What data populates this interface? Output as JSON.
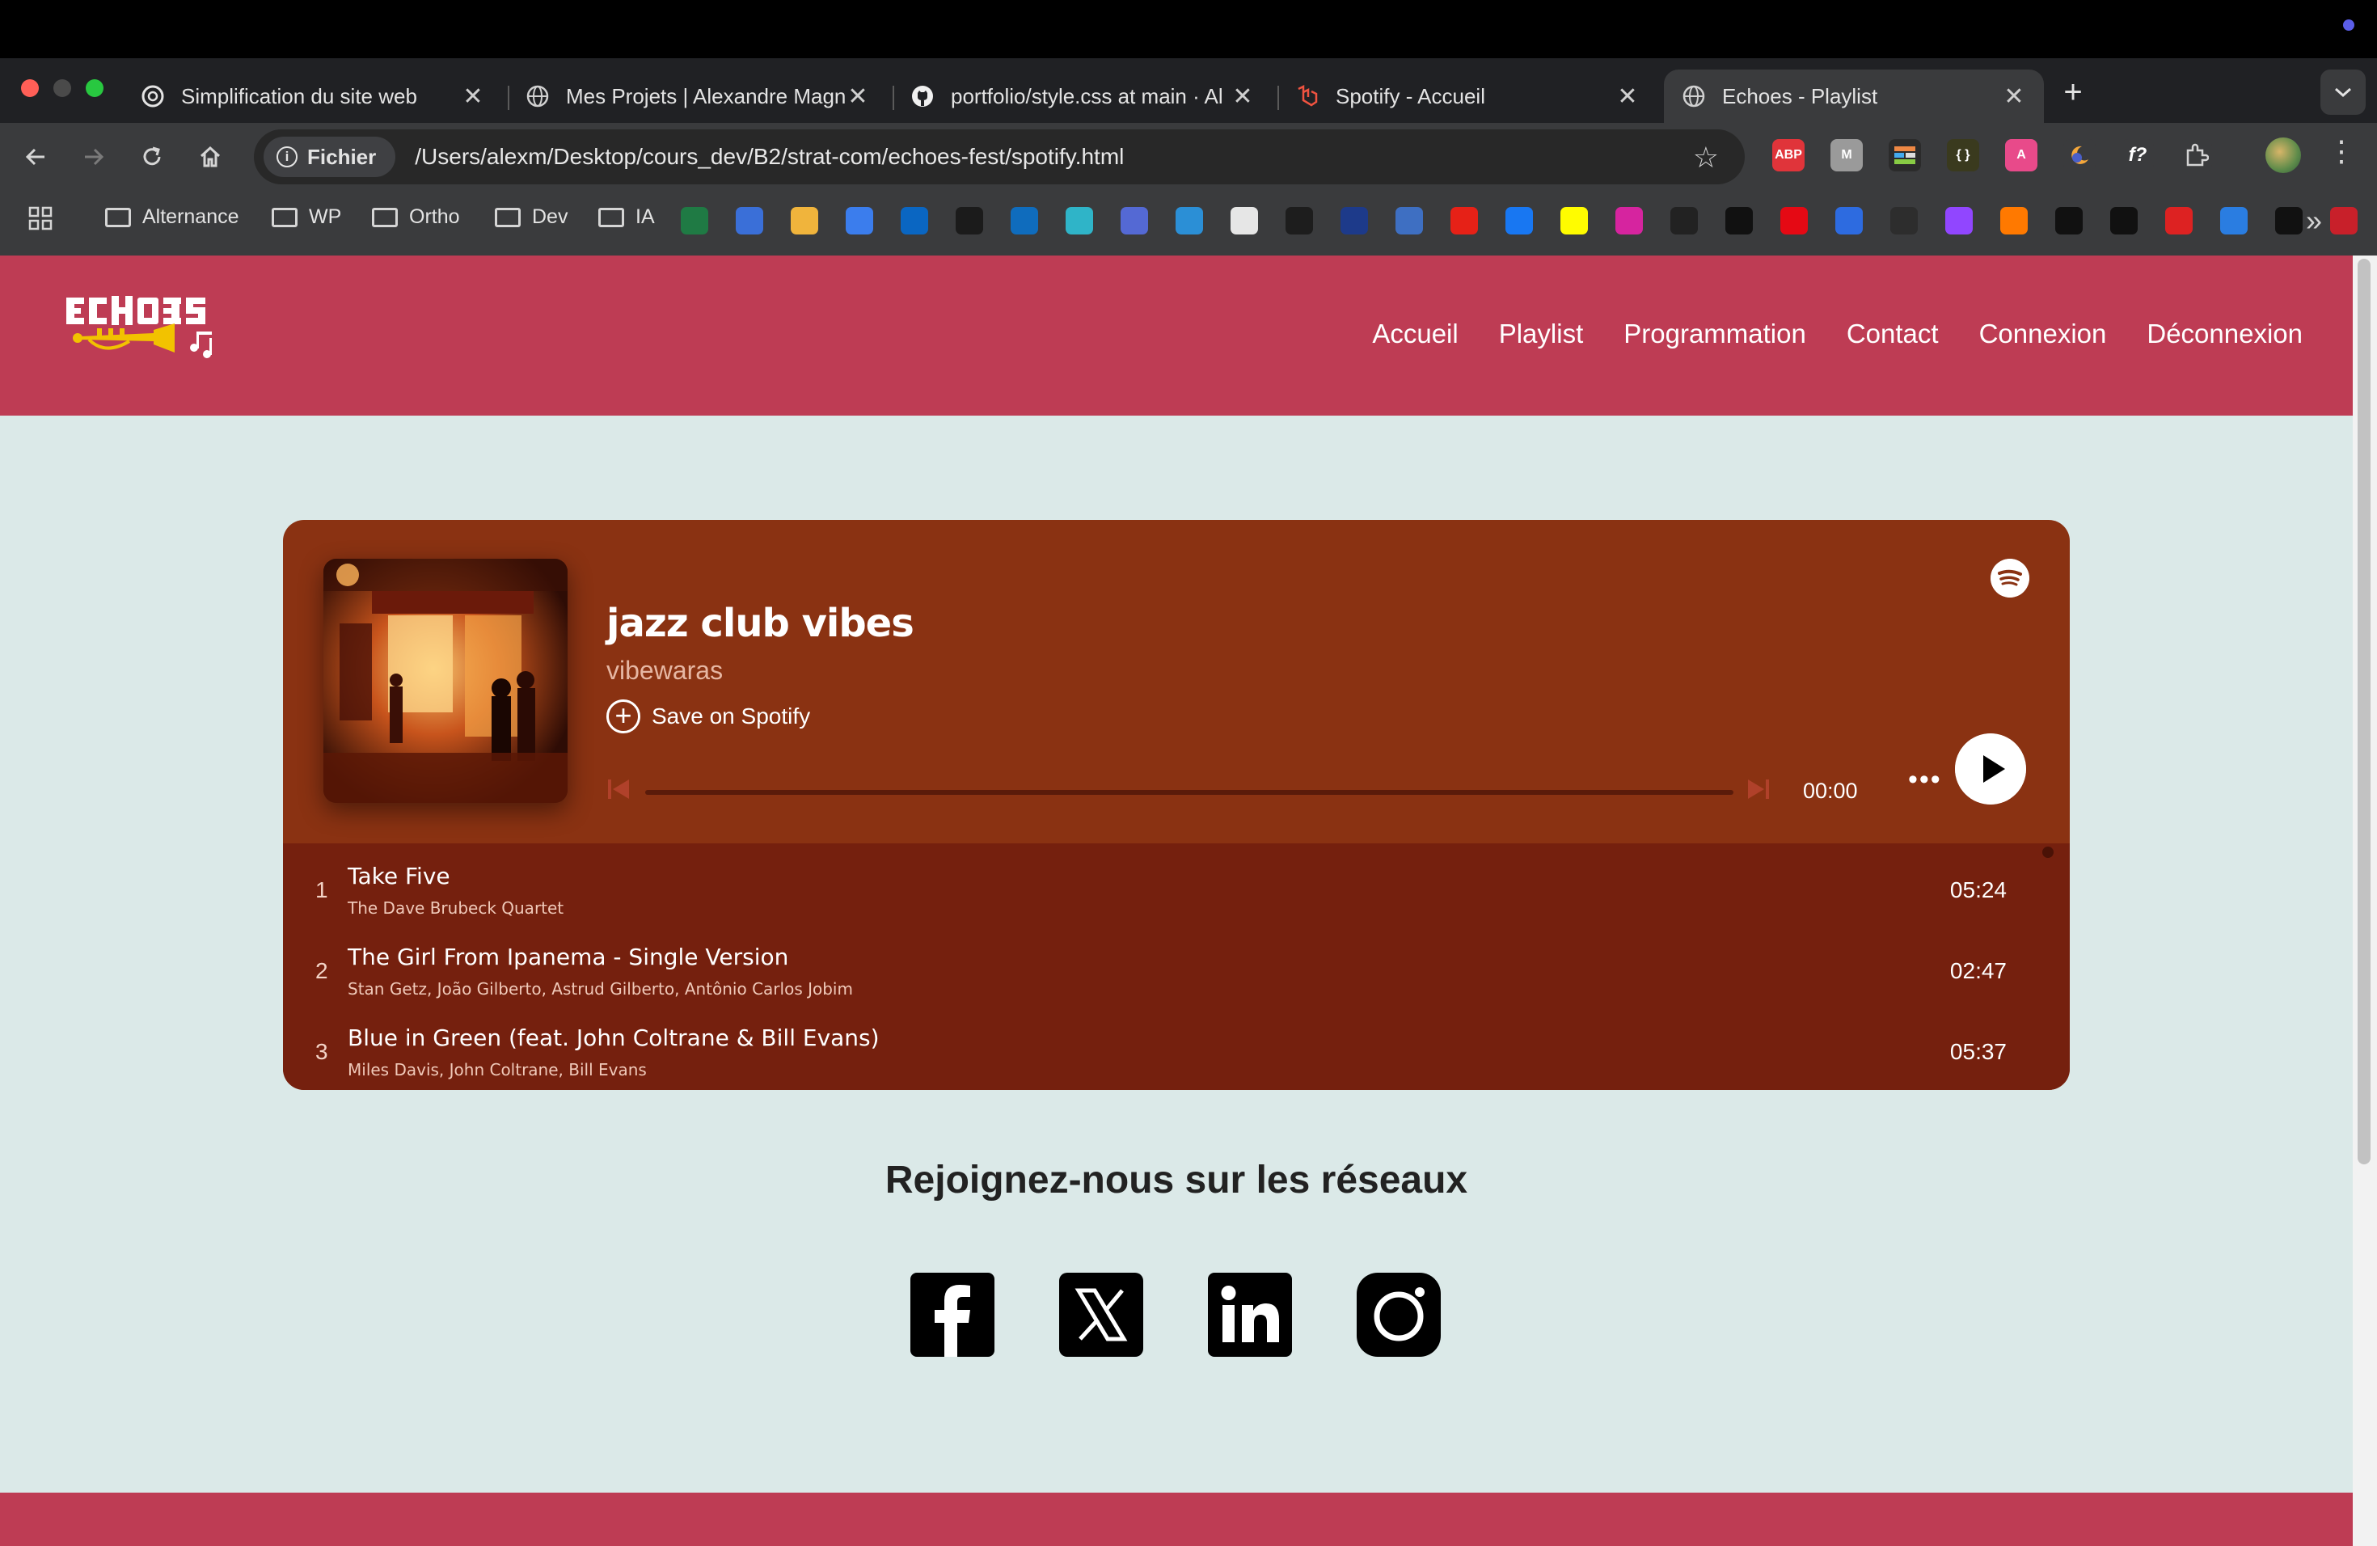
{
  "browser": {
    "tabs": [
      {
        "title": "Simplification du site web",
        "icon": "openai-icon",
        "active": false
      },
      {
        "title": "Mes Projets | Alexandre Magn",
        "icon": "globe-icon",
        "active": false
      },
      {
        "title": "portfolio/style.css at main · Al",
        "icon": "github-icon",
        "active": false
      },
      {
        "title": "Spotify - Accueil",
        "icon": "laravel-icon",
        "active": false
      },
      {
        "title": "Echoes - Playlist",
        "icon": "globe-icon",
        "active": true
      }
    ],
    "close_glyph": "✕",
    "new_tab_glyph": "+",
    "address": {
      "chip_label": "Fichier",
      "url": "/Users/alexm/Desktop/cours_dev/B2/strat-com/echoes-fest/spotify.html"
    },
    "extensions": [
      {
        "name": "adblock-icon",
        "label": "ABP",
        "color": "#e0343a"
      },
      {
        "name": "m-extension-icon",
        "label": "M",
        "color": "#9a9a9a"
      },
      {
        "name": "palette-extension-icon",
        "label": "",
        "color": "#2b2b2b"
      },
      {
        "name": "json-extension-icon",
        "label": "{ }",
        "color": "#3a3a1e"
      },
      {
        "name": "translate-extension-icon",
        "label": "A",
        "color": "#e84a8a"
      },
      {
        "name": "moon-extension-icon",
        "label": "",
        "color": "#3a3b3d"
      },
      {
        "name": "fonts-extension-icon",
        "label": "f?",
        "color": "#3a3b3d"
      },
      {
        "name": "puzzle-extensions-icon",
        "label": "",
        "color": "#3a3b3d"
      }
    ],
    "bookmark_folders": [
      "Alternance",
      "WP",
      "Ortho",
      "Dev",
      "IA"
    ],
    "bookmark_icons": [
      {
        "name": "excel-icon",
        "color": "#1f7a44"
      },
      {
        "name": "canva-icon",
        "color": "#3a6fd8"
      },
      {
        "name": "emoji-icon",
        "color": "#f0b43c"
      },
      {
        "name": "docs-icon",
        "color": "#3b7ded"
      },
      {
        "name": "linkedin-icon",
        "color": "#0a66c2"
      },
      {
        "name": "school-icon",
        "color": "#1b1b1b"
      },
      {
        "name": "outlook-icon",
        "color": "#0f6cbd"
      },
      {
        "name": "tplink-icon",
        "color": "#2fb4c8"
      },
      {
        "name": "figure-icon",
        "color": "#5469d4"
      },
      {
        "name": "refresh-app-icon",
        "color": "#2b8fd6"
      },
      {
        "name": "notes-icon",
        "color": "#e6e6e6"
      },
      {
        "name": "grid-app-icon",
        "color": "#1d1d1d"
      },
      {
        "name": "eu-icon",
        "color": "#1d3a8a"
      },
      {
        "name": "doc-app-icon",
        "color": "#3e6fc2"
      },
      {
        "name": "youtube-icon",
        "color": "#e62117"
      },
      {
        "name": "facebook-icon",
        "color": "#1877f2"
      },
      {
        "name": "snapchat-icon",
        "color": "#fffc00"
      },
      {
        "name": "instagram-icon",
        "color": "#d6249f"
      },
      {
        "name": "va-icon",
        "color": "#222"
      },
      {
        "name": "plus-app-icon",
        "color": "#111"
      },
      {
        "name": "netflix-icon",
        "color": "#e50914"
      },
      {
        "name": "play-app-icon",
        "color": "#2d6be0"
      },
      {
        "name": "eye-app-icon",
        "color": "#2d2d2d"
      },
      {
        "name": "twitch-icon",
        "color": "#9146ff"
      },
      {
        "name": "orange-app-icon",
        "color": "#ff7900"
      },
      {
        "name": "c-app-icon",
        "color": "#111"
      },
      {
        "name": "amazon-icon",
        "color": "#111"
      },
      {
        "name": "shield-app-icon",
        "color": "#d22"
      },
      {
        "name": "crown-app-icon",
        "color": "#2a7de1"
      },
      {
        "name": "playstation-icon",
        "color": "#111"
      },
      {
        "name": "crest-app-icon",
        "color": "#c8202a"
      }
    ]
  },
  "site": {
    "nav": [
      "Accueil",
      "Playlist",
      "Programmation",
      "Contact",
      "Connexion",
      "Déconnexion"
    ],
    "colors": {
      "brand": "#be3c54",
      "logo_yellow": "#f2c200",
      "page_bg": "#dbe9e8"
    }
  },
  "player": {
    "title": "jazz club vibes",
    "owner": "vibewaras",
    "save_label": "Save on Spotify",
    "time": "00:00",
    "more": "•••",
    "colors": {
      "header": "#8a3212",
      "list": "#75200e"
    },
    "tracks": [
      {
        "num": "1",
        "title": "Take Five",
        "artists": "The Dave Brubeck Quartet",
        "duration": "05:24"
      },
      {
        "num": "2",
        "title": "The Girl From Ipanema - Single Version",
        "artists": "Stan Getz, João Gilberto, Astrud Gilberto, Antônio Carlos Jobim",
        "duration": "02:47"
      },
      {
        "num": "3",
        "title": "Blue in Green (feat. John Coltrane & Bill Evans)",
        "artists": "Miles Davis, John Coltrane, Bill Evans",
        "duration": "05:37"
      }
    ]
  },
  "social": {
    "title": "Rejoignez-nous sur les réseaux",
    "networks": [
      "facebook-icon",
      "x-icon",
      "linkedin-icon",
      "instagram-icon"
    ]
  }
}
